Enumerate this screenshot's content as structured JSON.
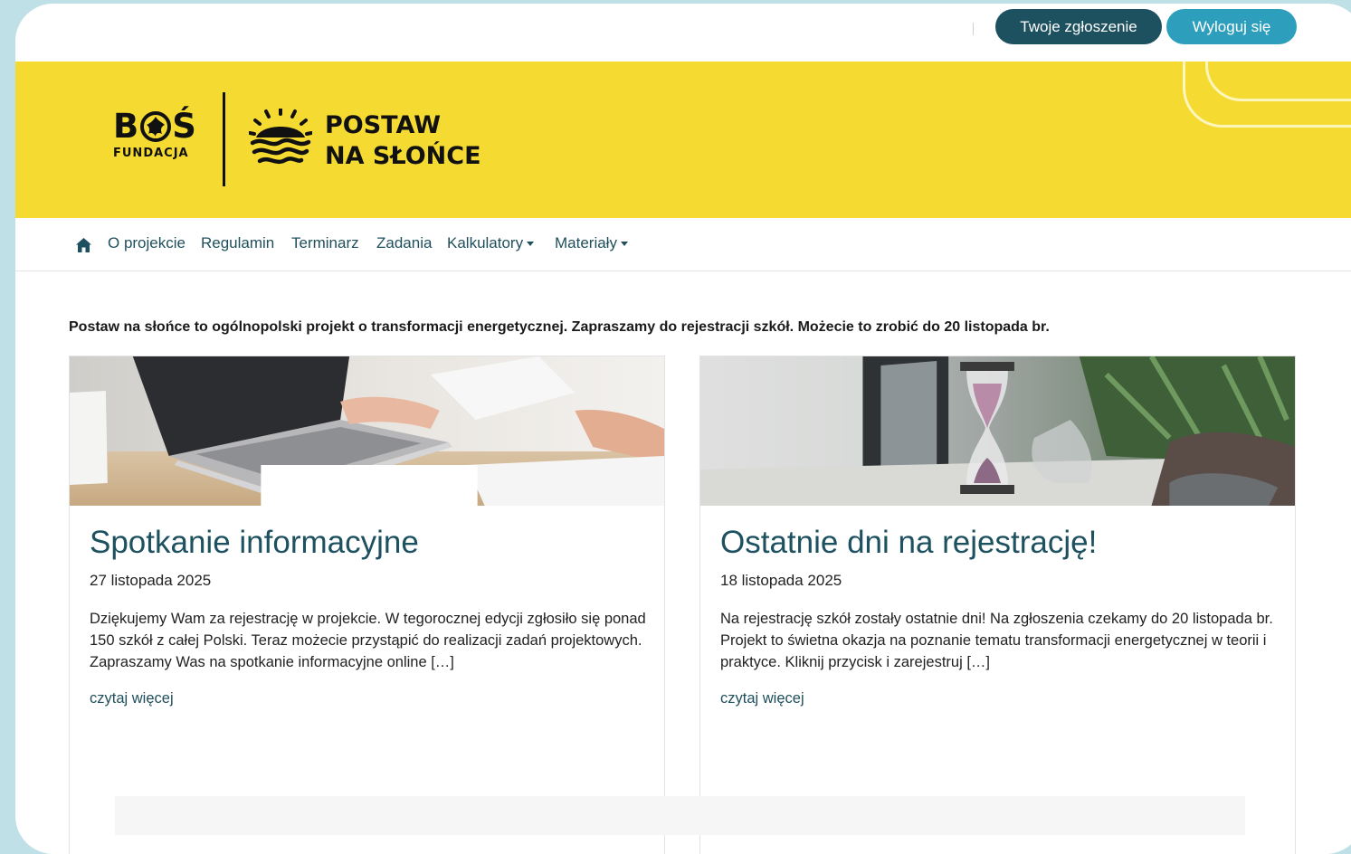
{
  "header": {
    "ticket_button": "Twoje zgłoszenie",
    "logout_button": "Wyloguj się"
  },
  "banner": {
    "bos_logo": "BOŚ",
    "bos_sub": "FUNDACJA",
    "project_logo_line1": "POSTAW",
    "project_logo_line2": "NA SŁOŃCE"
  },
  "nav": {
    "items": [
      "O projekcie",
      "Regulamin",
      "Terminarz",
      "Zadania",
      "Kalkulatory",
      "Materiały"
    ]
  },
  "intro_text": "Postaw na słońce to ogólnopolski projekt o transformacji energetycznej. Zapraszamy do rejestracji szkół. Możecie to zrobić do 20 listopada br.",
  "cards": [
    {
      "title": "Spotkanie informacyjne",
      "date": "27 listopada 2025",
      "text": "Dziękujemy Wam za rejestrację w projekcie. W tegorocznej edycji zgłosiło się ponad 150 szkół z całej Polski. Teraz możecie przystąpić do realizacji zadań projektowych. Zapraszamy Was na spotkanie informacyjne online […]",
      "link": "czytaj więcej"
    },
    {
      "title": "Ostatnie dni na rejestrację!",
      "date": "18 listopada 2025",
      "text": "Na rejestrację szkół zostały ostatnie dni! Na zgłoszenia czekamy do 20 listopada br. Projekt to świetna okazja na poznanie tematu transformacji energetycznej w teorii i praktyce. Kliknij przycisk i zarejestruj […]",
      "link": "czytaj więcej"
    }
  ],
  "colors": {
    "banner_yellow": "#f5db31",
    "primary_dark": "#1d5160",
    "accent_teal": "#2e9ebd",
    "background_frame": "#bfe0e6"
  },
  "icons": [
    "home-icon",
    "caret-down-icon",
    "sun-logo-icon",
    "flower-logo-icon"
  ]
}
